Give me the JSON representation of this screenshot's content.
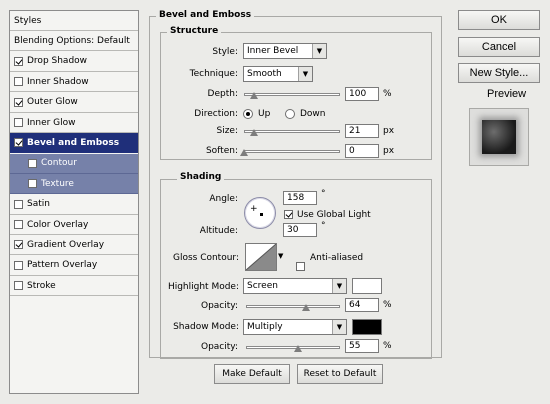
{
  "styles_panel": {
    "header": "Styles",
    "items": [
      {
        "label": "Blending Options: Default",
        "checkbox": false,
        "checked": false
      },
      {
        "label": "Drop Shadow",
        "checkbox": true,
        "checked": true
      },
      {
        "label": "Inner Shadow",
        "checkbox": true,
        "checked": false
      },
      {
        "label": "Outer Glow",
        "checkbox": true,
        "checked": true
      },
      {
        "label": "Inner Glow",
        "checkbox": true,
        "checked": false
      },
      {
        "label": "Bevel and Emboss",
        "checkbox": true,
        "checked": true,
        "selected": true
      },
      {
        "label": "Contour",
        "checkbox": true,
        "checked": false,
        "sub": true
      },
      {
        "label": "Texture",
        "checkbox": true,
        "checked": false,
        "sub": true
      },
      {
        "label": "Satin",
        "checkbox": true,
        "checked": false
      },
      {
        "label": "Color Overlay",
        "checkbox": true,
        "checked": false
      },
      {
        "label": "Gradient Overlay",
        "checkbox": true,
        "checked": true
      },
      {
        "label": "Pattern Overlay",
        "checkbox": true,
        "checked": false
      },
      {
        "label": "Stroke",
        "checkbox": true,
        "checked": false
      }
    ]
  },
  "bevel": {
    "title": "Bevel and Emboss",
    "structure": {
      "title": "Structure",
      "style_label": "Style:",
      "style_value": "Inner Bevel",
      "technique_label": "Technique:",
      "technique_value": "Smooth",
      "depth_label": "Depth:",
      "depth_value": "100",
      "depth_unit": "%",
      "depth_level": 0.1,
      "direction_label": "Direction:",
      "direction_up": "Up",
      "direction_down": "Down",
      "size_label": "Size:",
      "size_value": "21",
      "size_unit": "px",
      "size_level": 0.1,
      "soften_label": "Soften:",
      "soften_value": "0",
      "soften_unit": "px",
      "soften_level": 0.0
    },
    "shading": {
      "title": "Shading",
      "angle_label": "Angle:",
      "angle_value": "158",
      "angle_unit": "°",
      "global_light_label": "Use Global Light",
      "altitude_label": "Altitude:",
      "altitude_value": "30",
      "altitude_unit": "°",
      "gloss_label": "Gloss Contour:",
      "anti_aliased_label": "Anti-aliased",
      "highlight_label": "Highlight Mode:",
      "highlight_value": "Screen",
      "highlight_color": "#ffffff",
      "highlight_opacity_label": "Opacity:",
      "highlight_opacity_value": "64",
      "highlight_opacity_unit": "%",
      "highlight_opacity_level": 0.64,
      "shadow_label": "Shadow Mode:",
      "shadow_value": "Multiply",
      "shadow_color": "#000000",
      "shadow_opacity_label": "Opacity:",
      "shadow_opacity_value": "55",
      "shadow_opacity_unit": "%",
      "shadow_opacity_level": 0.55
    },
    "make_default": "Make Default",
    "reset_default": "Reset to Default"
  },
  "right": {
    "ok": "OK",
    "cancel": "Cancel",
    "new_style": "New Style...",
    "preview_label": "Preview"
  },
  "colors": {
    "selected_row": "#1f2f7a",
    "sub_row": "#7681a9"
  }
}
